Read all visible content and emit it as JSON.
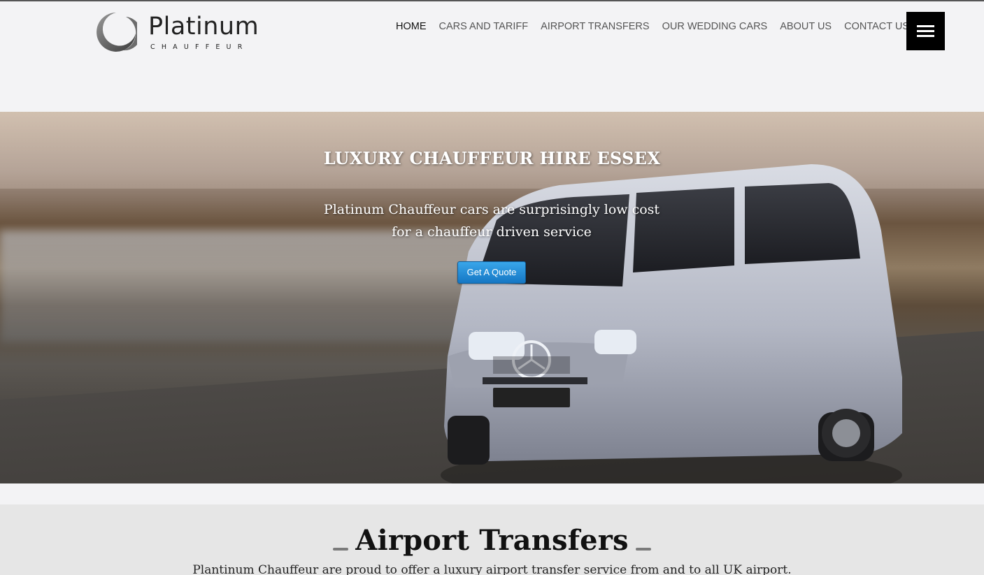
{
  "header": {
    "logo": {
      "title": "Platinum",
      "subtitle": "CHAUFFEUR"
    },
    "nav": [
      {
        "label": "HOME",
        "active": true
      },
      {
        "label": "CARS AND TARIFF",
        "active": false
      },
      {
        "label": "AIRPORT TRANSFERS",
        "active": false
      },
      {
        "label": "OUR WEDDING CARS",
        "active": false
      },
      {
        "label": "ABOUT US",
        "active": false
      },
      {
        "label": "CONTACT US",
        "active": false
      }
    ],
    "menu_icon": "hamburger-menu-icon"
  },
  "hero": {
    "title": "LUXURY CHAUFFEUR HIRE ESSEX",
    "subtitle": "Platinum Chauffeur cars are surprisingly low cost for a chauffeur driven service",
    "cta_label": "Get A Quote"
  },
  "airport_section": {
    "title": "Airport Transfers",
    "text": "Plantinum Chauffeur are proud to offer a luxury airport transfer service from and to all UK airport."
  },
  "colors": {
    "header_bg": "#f3f3f5",
    "menu_button": "#000000",
    "cta_button": "#1f86d3",
    "section_bg": "#e6e6e6"
  }
}
